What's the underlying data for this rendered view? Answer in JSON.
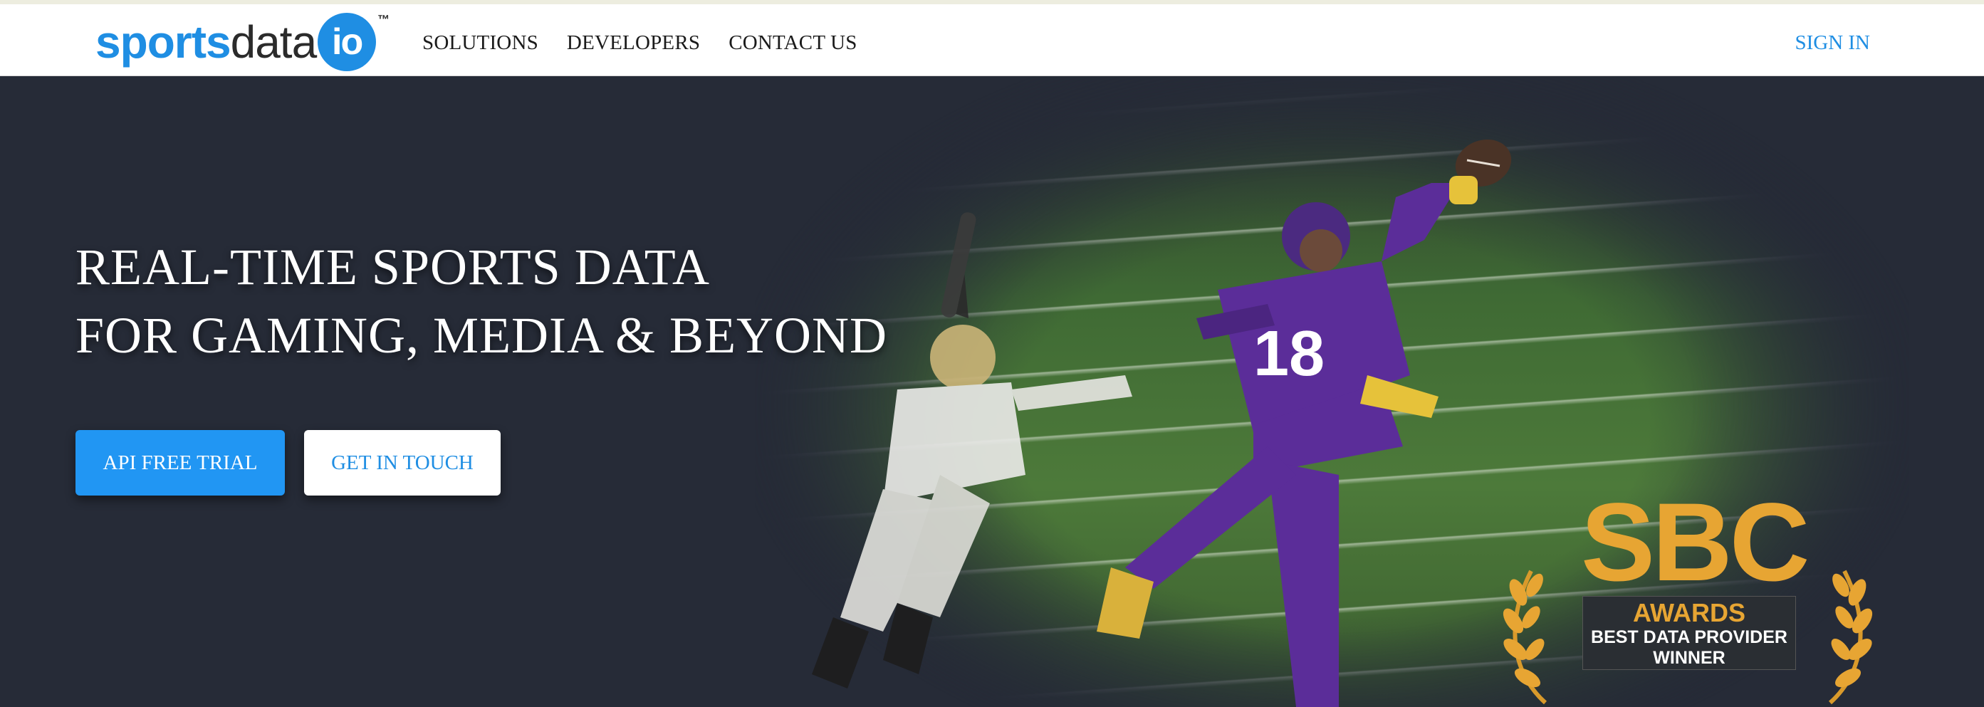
{
  "header": {
    "logo": {
      "sports": "sports",
      "data": "data",
      "io": "io",
      "tm": "™"
    },
    "nav": [
      {
        "label": "SOLUTIONS"
      },
      {
        "label": "DEVELOPERS"
      },
      {
        "label": "CONTACT US"
      }
    ],
    "sign_in": "SIGN IN"
  },
  "hero": {
    "headline_line1": "REAL-TIME SPORTS DATA",
    "headline_line2": "FOR GAMING, MEDIA & BEYOND",
    "primary_button": "API FREE TRIAL",
    "secondary_button": "GET IN TOUCH",
    "player_number": "18"
  },
  "award": {
    "title": "SBC",
    "line1": "AWARDS",
    "line2": "BEST DATA PROVIDER",
    "line3": "WINNER"
  },
  "colors": {
    "brand_blue": "#1f8ee3",
    "button_blue": "#2196f3",
    "hero_bg": "#262b37",
    "award_gold": "#e7a533",
    "jersey_purple": "#5b2d99"
  },
  "icons": [
    "sportsdataio-logo",
    "laurel-left-icon",
    "laurel-right-icon",
    "football-player-photo"
  ]
}
